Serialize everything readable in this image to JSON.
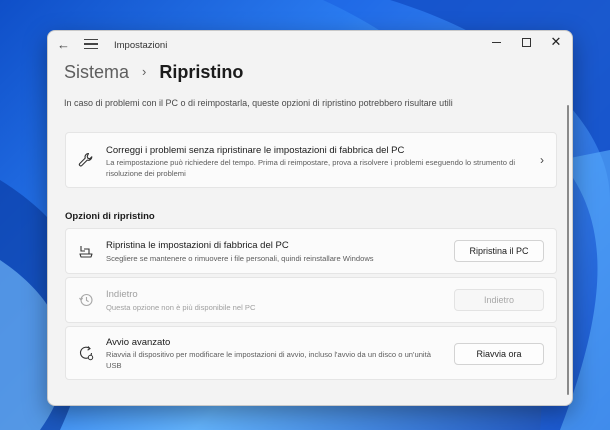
{
  "window": {
    "title": "Impostazioni"
  },
  "breadcrumb": {
    "parent": "Sistema",
    "separator": "›",
    "current": "Ripristino"
  },
  "intro": "In caso di problemi con il PC o di reimpostarla, queste opzioni di ripristino potrebbero risultare utili",
  "troubleshoot": {
    "title": "Correggi i problemi senza ripristinare le impostazioni di fabbrica del PC",
    "description": "La reimpostazione può richiedere del tempo. Prima di reimpostare, prova a risolvere i problemi eseguendo lo strumento di risoluzione dei problemi",
    "icon": "wrench-icon",
    "chevron": "›"
  },
  "section_title": "Opzioni di ripristino",
  "options": [
    {
      "title": "Ripristina le impostazioni di fabbrica del PC",
      "description": "Scegliere se mantenere o rimuovere i file personali, quindi reinstallare Windows",
      "button": "Ripristina il PC",
      "icon": "reset-pc-icon",
      "enabled": true
    },
    {
      "title": "Indietro",
      "description": "Questa opzione non è più disponibile nel PC",
      "button": "Indietro",
      "icon": "history-icon",
      "enabled": false
    },
    {
      "title": "Avvio avanzato",
      "description": "Riavvia il dispositivo per modificare le impostazioni di avvio, incluso l'avvio da un disco o un'unità USB",
      "button": "Riavvia ora",
      "icon": "advanced-startup-icon",
      "enabled": true
    }
  ],
  "colors": {
    "window_bg": "#f3f3f3",
    "card_bg": "#fbfbfb",
    "wallpaper": "#1e64e0"
  }
}
